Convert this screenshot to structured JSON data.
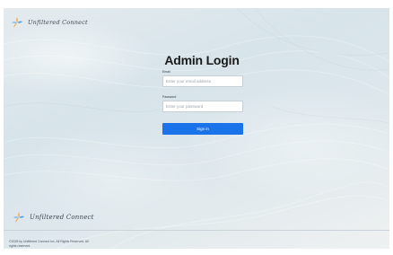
{
  "brand": {
    "name": "Unfiltered Connect",
    "logo_icon": "sparkle-flower-icon",
    "logo_colors": [
      "#f2a33a",
      "#4a9be8",
      "#f2a33a"
    ]
  },
  "login": {
    "title": "Admin Login",
    "email_label": "Email",
    "email_placeholder": "Enter your email address",
    "password_label": "Password",
    "password_placeholder": "Enter your password",
    "submit_label": "Sign in"
  },
  "footer": {
    "copyright": "©2025 by Unfiltered Connect Inc. All Rights Reserved. All rights reserved."
  },
  "colors": {
    "accent": "#1a73e8"
  }
}
